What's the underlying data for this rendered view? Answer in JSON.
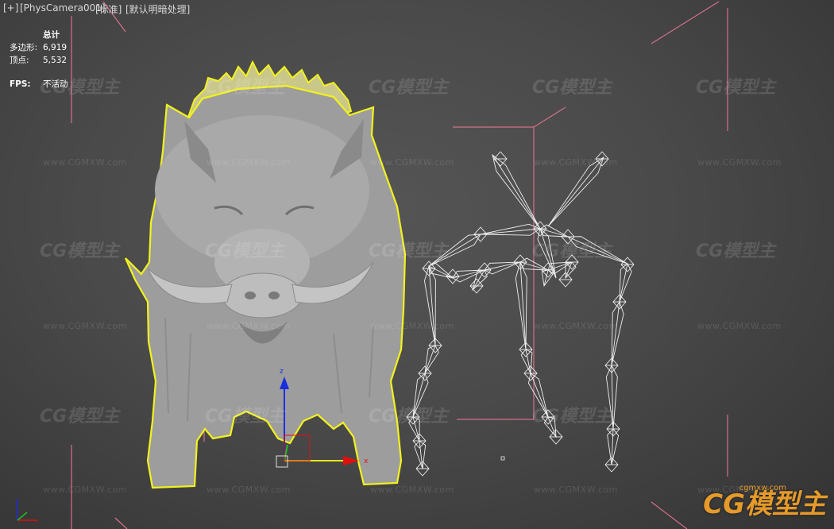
{
  "viewport": {
    "label_plus": "[+]",
    "label_camera": "[PhysCamera001]",
    "label_shading": "[标准]",
    "label_lighting": "[默认明暗处理]"
  },
  "stats": {
    "header": "总计",
    "polys_label": "多边形:",
    "polys_value": "6,919",
    "verts_label": "顶点:",
    "verts_value": "5,532",
    "fps_label": "FPS:",
    "fps_value": "不活动"
  },
  "watermark": {
    "logo_text": "CG模型主",
    "url_text": "www.CGMXW.com",
    "corner_url": "cgmxw.com"
  },
  "colors": {
    "selection_yellow": "#f2f21e",
    "camera_pink": "#d4708a",
    "gizmo_red": "#e01010",
    "gizmo_green": "#20c020",
    "gizmo_blue": "#1a2ee0",
    "bone_white": "#f0f0f0",
    "watermark_orange": "#e59a2a"
  }
}
